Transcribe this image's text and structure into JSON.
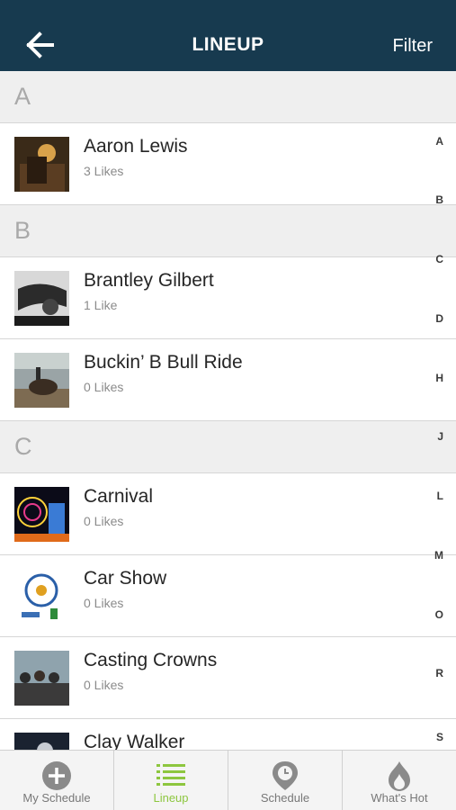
{
  "header": {
    "title": "LINEUP",
    "filter_label": "Filter"
  },
  "sections": [
    {
      "letter": "A",
      "items": [
        {
          "name": "Aaron Lewis",
          "likes": "3 Likes"
        }
      ]
    },
    {
      "letter": "B",
      "items": [
        {
          "name": "Brantley Gilbert",
          "likes": "1 Like"
        },
        {
          "name": "Buckin’ B Bull Ride",
          "likes": "0 Likes"
        }
      ]
    },
    {
      "letter": "C",
      "items": [
        {
          "name": "Carnival",
          "likes": "0 Likes"
        },
        {
          "name": "Car Show",
          "likes": "0 Likes"
        },
        {
          "name": "Casting Crowns",
          "likes": "0 Likes"
        },
        {
          "name": "Clay Walker",
          "likes": ""
        }
      ]
    }
  ],
  "index_letters": [
    "A",
    "B",
    "C",
    "D",
    "H",
    "J",
    "L",
    "M",
    "O",
    "R",
    "S"
  ],
  "tabs": [
    {
      "label": "My Schedule",
      "icon": "plus-circle-icon",
      "active": false
    },
    {
      "label": "Lineup",
      "icon": "list-icon",
      "active": true
    },
    {
      "label": "Schedule",
      "icon": "map-pin-icon",
      "active": false
    },
    {
      "label": "What's Hot",
      "icon": "flame-icon",
      "active": false
    }
  ],
  "colors": {
    "header_bg": "#173a4f",
    "accent": "#8dc63f",
    "section_bg": "#efefef"
  }
}
